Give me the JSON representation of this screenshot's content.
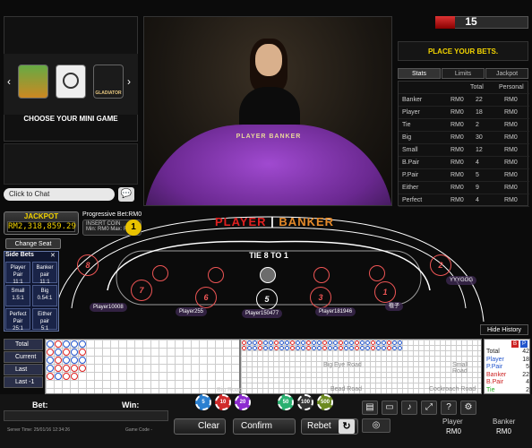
{
  "mini_games": {
    "caption": "CHOOSE YOUR MINI GAME",
    "thumbs": [
      "Gladiator"
    ],
    "thumb_label": "GLADIATOR"
  },
  "chat": {
    "label": "Click to Chat"
  },
  "video": {
    "table_label": "PLAYER   BANKER"
  },
  "timer": {
    "value": "15"
  },
  "status": {
    "message": "PLACE YOUR BETS."
  },
  "tabs": [
    "Stats",
    "Limits",
    "Jackpot"
  ],
  "stats": {
    "headers": [
      "Total",
      "Personal"
    ],
    "rows": [
      {
        "name": "Banker",
        "cur": "RM0",
        "total": "22",
        "personal": "RM0"
      },
      {
        "name": "Player",
        "cur": "RM0",
        "total": "18",
        "personal": "RM0"
      },
      {
        "name": "Tie",
        "cur": "RM0",
        "total": "2",
        "personal": "RM0"
      },
      {
        "name": "Big",
        "cur": "RM0",
        "total": "30",
        "personal": "RM0"
      },
      {
        "name": "Small",
        "cur": "RM0",
        "total": "12",
        "personal": "RM0"
      },
      {
        "name": "B.Pair",
        "cur": "RM0",
        "total": "4",
        "personal": "RM0"
      },
      {
        "name": "P.Pair",
        "cur": "RM0",
        "total": "5",
        "personal": "RM0"
      },
      {
        "name": "Either",
        "cur": "RM0",
        "total": "9",
        "personal": "RM0"
      },
      {
        "name": "Perfect",
        "cur": "RM0",
        "total": "4",
        "personal": "RM0"
      }
    ]
  },
  "jackpot": {
    "title": "JACKPOT",
    "amount": "RM2,318,859.29",
    "progressive_bet": "Progressive Bet:RM0",
    "insert_coin": "INSERT COIN",
    "min_max": "Min: RM0 Max: RM0",
    "coin_num": "1"
  },
  "table": {
    "title_player": "PLAYER",
    "title_sep": " | ",
    "title_banker": "BANKER",
    "tie": "TIE 8 TO 1",
    "change_seat": "Change Seat",
    "hide_history": "Hide History",
    "seats": [
      "8",
      "7",
      "6",
      "5",
      "3",
      "1",
      "2"
    ],
    "players": [
      "Player10008",
      "Player255",
      "Player150477",
      "Player181946",
      "植子",
      "YYYGGG"
    ]
  },
  "side_bets": {
    "title": "Side Bets",
    "close": "✕",
    "cells": [
      {
        "label": "Player Pair",
        "odds": "11:1"
      },
      {
        "label": "Banker pair",
        "odds": "11:1"
      },
      {
        "label": "Small",
        "odds": "1.5:1"
      },
      {
        "label": "Big",
        "odds": "0.54:1"
      },
      {
        "label": "Perfect Pair",
        "odds": "25:1"
      },
      {
        "label": "Either pair",
        "odds": "5:1"
      }
    ]
  },
  "roads": {
    "buttons": [
      "Total",
      "Current",
      "Last",
      "Last -1"
    ],
    "big_eye": "Big Eye Road",
    "small": "Small Road",
    "big": "Big Road",
    "bead": "Bead Road",
    "cockroach": "Cockroach Road"
  },
  "counts": [
    {
      "label": "Total",
      "value": "42",
      "color": "#222"
    },
    {
      "label": "Player",
      "value": "18",
      "color": "#2255cc"
    },
    {
      "label": "P.Pair",
      "value": "5",
      "color": "#2255cc"
    },
    {
      "label": "Banker",
      "value": "22",
      "color": "#cc2222"
    },
    {
      "label": "B.Pair",
      "value": "4",
      "color": "#cc2222"
    },
    {
      "label": "Tie",
      "value": "2",
      "color": "#22aa22"
    }
  ],
  "count_headers": [
    "B",
    "P"
  ],
  "bottom": {
    "bet_label": "Bet:",
    "win_label": "Win:",
    "server_time": "Server Time: 25/01/16 12:34:26",
    "game_code": "Game Code -",
    "chips": [
      "5",
      "10",
      "20",
      "50",
      "100",
      "500"
    ],
    "clear": "Clear",
    "confirm": "Confirm",
    "rebet": "Rebet",
    "player_label": "Player",
    "banker_label": "Banker",
    "player_value": "RM0",
    "banker_value": "RM0"
  },
  "colors": {
    "accent_yellow": "#f3d400",
    "felt": "#9a6dc4",
    "player": "#e02020",
    "banker": "#e58a2a"
  }
}
